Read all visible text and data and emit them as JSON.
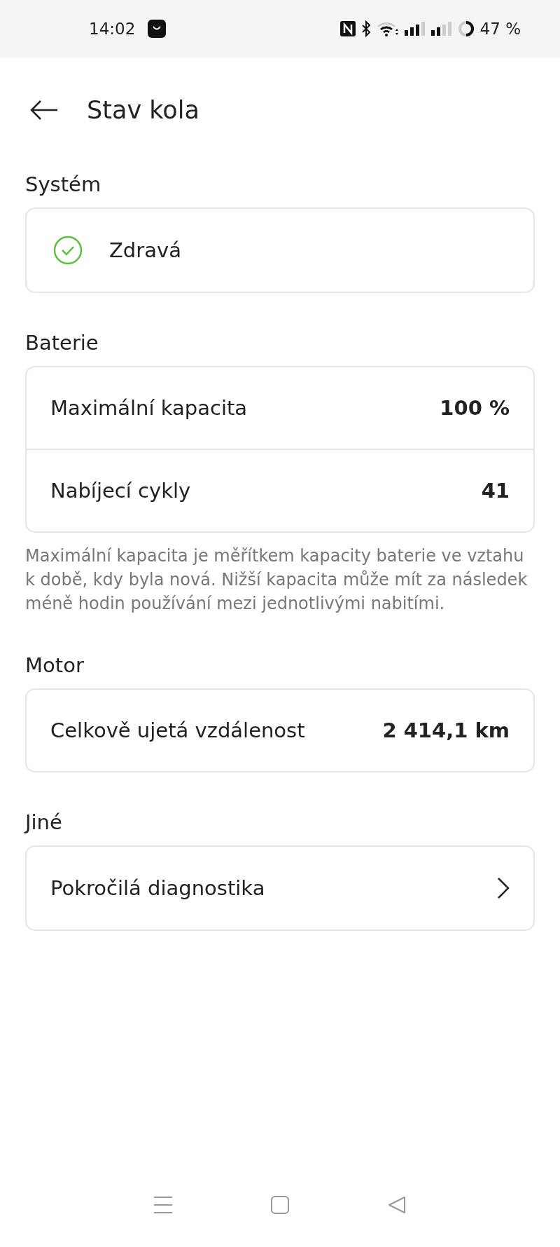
{
  "status_bar": {
    "time": "14:02",
    "battery": "47 %"
  },
  "header": {
    "title": "Stav kola"
  },
  "sections": [
    {
      "kind": "status",
      "title": "Systém",
      "status": {
        "label": "Zdravá",
        "healthy": true
      }
    },
    {
      "kind": "rows",
      "title": "Baterie",
      "rows": [
        {
          "label": "Maximální kapacita",
          "value": "100 %"
        },
        {
          "label": "Nabíjecí cykly",
          "value": "41"
        }
      ],
      "note": "Maximální kapacita je měřítkem kapacity baterie ve vztahu k době, kdy byla nová. Nižší kapacita může mít za následek méně hodin používání mezi jednotlivými nabitími."
    },
    {
      "kind": "rows",
      "title": "Motor",
      "rows": [
        {
          "label": "Celkově ujetá vzdálenost",
          "value": "2 414,1 km"
        }
      ]
    },
    {
      "kind": "link",
      "title": "Jiné",
      "link": {
        "label": "Pokročilá diagnostika"
      }
    }
  ]
}
